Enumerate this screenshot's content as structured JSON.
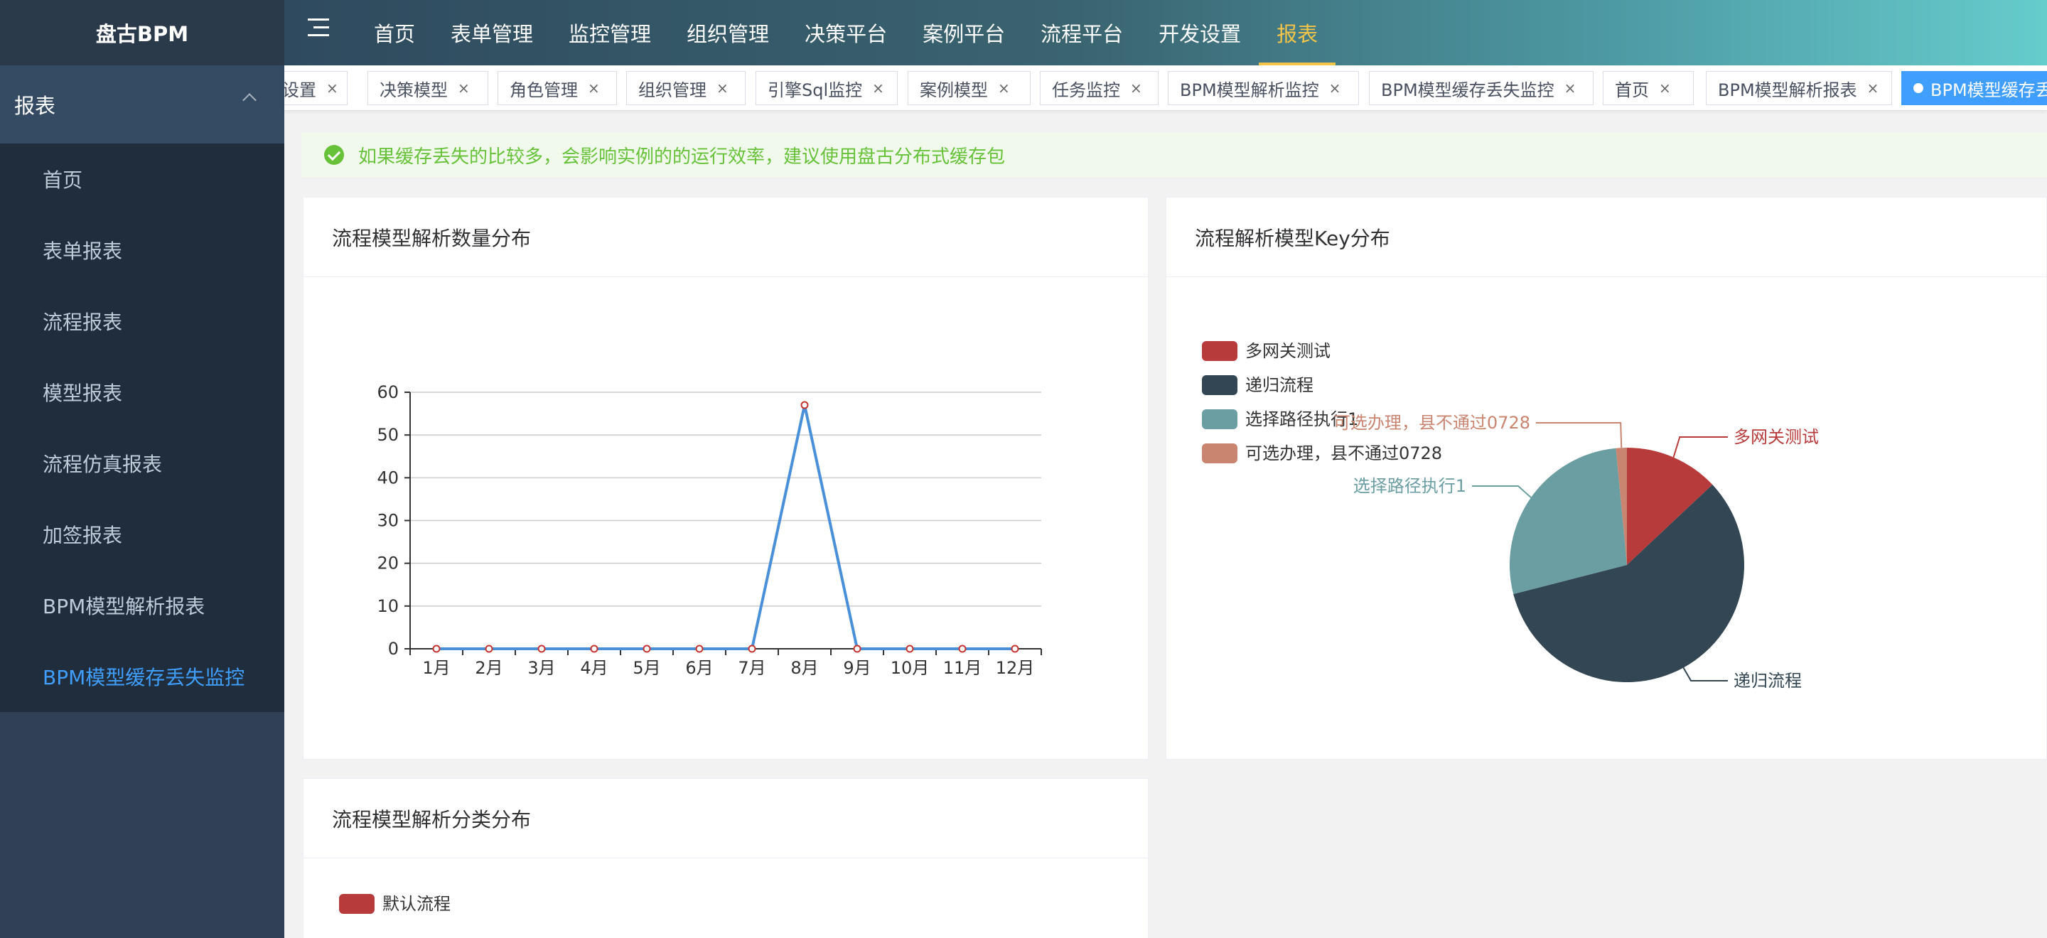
{
  "sidebar": {
    "brand": "盘古BPM",
    "group_label": "报表",
    "items": [
      {
        "label": "首页",
        "active": false
      },
      {
        "label": "表单报表",
        "active": false
      },
      {
        "label": "流程报表",
        "active": false
      },
      {
        "label": "模型报表",
        "active": false
      },
      {
        "label": "流程仿真报表",
        "active": false
      },
      {
        "label": "加签报表",
        "active": false
      },
      {
        "label": "BPM模型解析报表",
        "active": false
      },
      {
        "label": "BPM模型缓存丢失监控",
        "active": true
      }
    ]
  },
  "topnav": {
    "items": [
      {
        "label": "首页",
        "active": false
      },
      {
        "label": "表单管理",
        "active": false
      },
      {
        "label": "监控管理",
        "active": false
      },
      {
        "label": "组织管理",
        "active": false
      },
      {
        "label": "决策平台",
        "active": false
      },
      {
        "label": "案例平台",
        "active": false
      },
      {
        "label": "流程平台",
        "active": false
      },
      {
        "label": "开发设置",
        "active": false
      },
      {
        "label": "报表",
        "active": true
      }
    ],
    "accent_color": "#f4c548"
  },
  "tags": [
    {
      "label": "设置",
      "active": false
    },
    {
      "label": "决策模型",
      "active": false
    },
    {
      "label": "角色管理",
      "active": false
    },
    {
      "label": "组织管理",
      "active": false
    },
    {
      "label": "引擎Sql监控",
      "active": false
    },
    {
      "label": "案例模型",
      "active": false
    },
    {
      "label": "任务监控",
      "active": false
    },
    {
      "label": "BPM模型解析监控",
      "active": false
    },
    {
      "label": "BPM模型缓存丢失监控",
      "active": false
    },
    {
      "label": "首页",
      "active": false
    },
    {
      "label": "BPM模型解析报表",
      "active": false
    },
    {
      "label": "BPM模型缓存丢失监控",
      "active": true
    }
  ],
  "alert": {
    "text": "如果缓存丢失的比较多，会影响实例的的运行效率，建议使用盘古分布式缓存包"
  },
  "cards": {
    "line_title": "流程模型解析数量分布",
    "pie_title": "流程解析模型Key分布",
    "category_title": "流程模型解析分类分布"
  },
  "chart_data": [
    {
      "type": "line",
      "categories": [
        "1月",
        "2月",
        "3月",
        "4月",
        "5月",
        "6月",
        "7月",
        "8月",
        "9月",
        "10月",
        "11月",
        "12月"
      ],
      "series": [
        {
          "values": [
            0,
            0,
            0,
            0,
            0,
            0,
            0,
            57,
            0,
            0,
            0,
            0
          ],
          "color": "#4a90d9"
        }
      ],
      "ylim": [
        0,
        60
      ],
      "yticks": [
        0,
        10,
        20,
        30,
        40,
        50,
        60
      ],
      "grid": true
    },
    {
      "type": "pie",
      "legend_position": "top-left",
      "slices": [
        {
          "name": "多网关测试",
          "value": 13,
          "color": "#b83b3b"
        },
        {
          "name": "递归流程",
          "value": 58,
          "color": "#334653"
        },
        {
          "name": "选择路径执行1",
          "value": 27.5,
          "color": "#6a9ea3"
        },
        {
          "name": "可选办理，县不通过0728",
          "value": 1.5,
          "color": "#c98570"
        }
      ]
    },
    {
      "type": "pie",
      "legend_position": "top-left",
      "slices": [
        {
          "name": "默认流程",
          "color": "#b83b3b"
        }
      ]
    }
  ]
}
